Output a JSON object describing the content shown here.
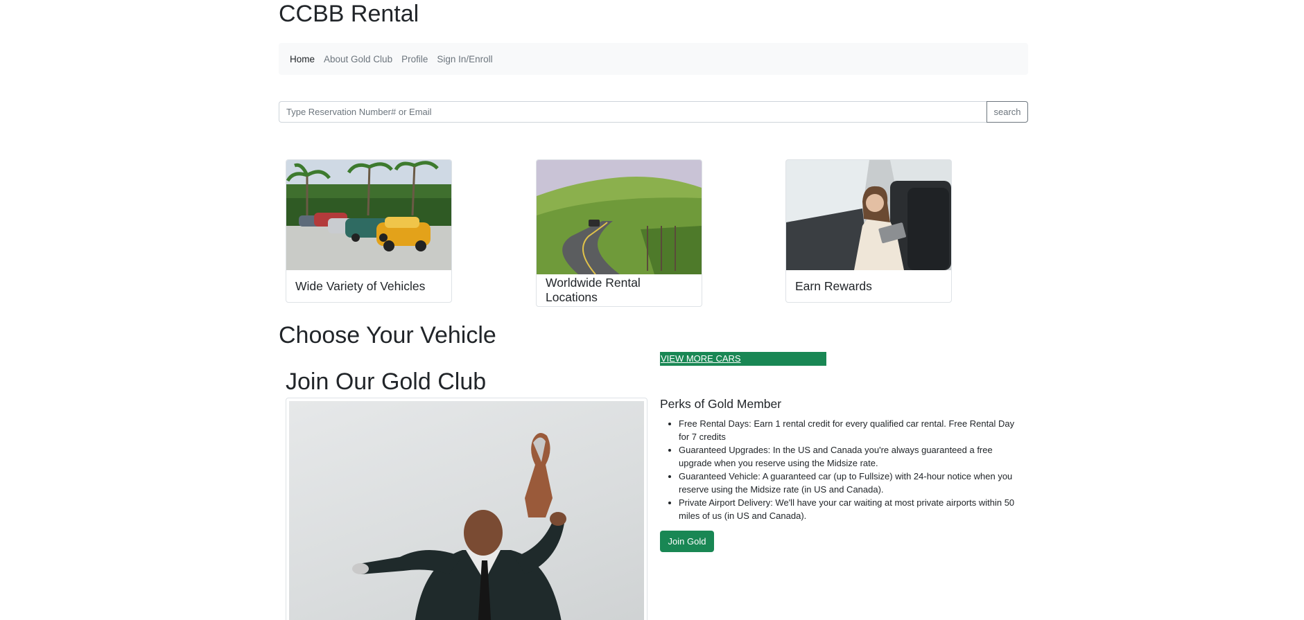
{
  "site": {
    "title": "CCBB Rental"
  },
  "nav": {
    "items": [
      {
        "label": "Home"
      },
      {
        "label": "About Gold Club"
      },
      {
        "label": "Profile"
      },
      {
        "label": "Sign In/Enroll"
      }
    ]
  },
  "search": {
    "placeholder": "Type Reservation Number# or Email",
    "value": "",
    "button_label": "search"
  },
  "features": [
    {
      "title": "Wide Variety of Vehicles"
    },
    {
      "title": "Worldwide Rental Locations"
    },
    {
      "title": "Earn Rewards"
    }
  ],
  "vehicles": {
    "heading": "Choose Your Vehicle",
    "more_label": "VIEW MORE CARS"
  },
  "gold": {
    "heading": "Join Our Gold Club",
    "perks_title": "Perks of Gold Member",
    "perks": [
      "Free Rental Days: Earn 1 rental credit for every qualified car rental. Free Rental Day for 7 credits",
      "Guaranteed Upgrades: In the US and Canada you're always guaranteed a free upgrade when you reserve using the Midsize rate.",
      "Guaranteed Vehicle: A guaranteed car (up to Fullsize) with 24-hour notice when you reserve using the Midsize rate (in US and Canada).",
      "Private Airport Delivery: We'll have your car waiting at most private airports within 50 miles of us (in US and Canada)."
    ],
    "join_label": "Join Gold"
  },
  "colors": {
    "accent": "#198754",
    "navbar_bg": "#f8f9fa",
    "text": "#212529",
    "muted": "#6c757d"
  }
}
